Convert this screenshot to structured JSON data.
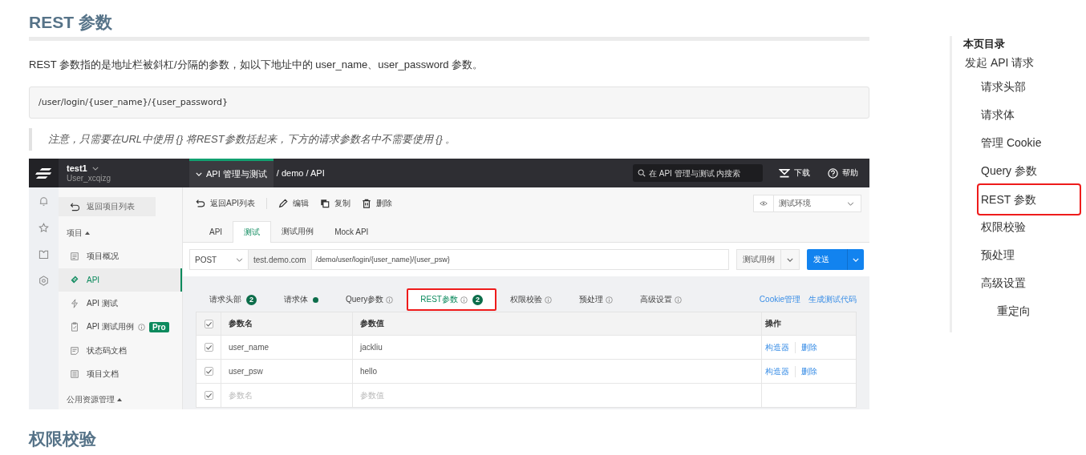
{
  "article": {
    "heading": "REST 参数",
    "intro": "REST 参数指的是地址栏被斜杠/分隔的参数，如以下地址中的 user_name、user_password 参数。",
    "code": "/user/login/{user_name}/{user_password}",
    "note": "注意，只需要在URL中使用 {} 将REST参数括起来，下方的请求参数名中不需要使用 {} 。",
    "next_heading": "权限校验"
  },
  "app": {
    "project": {
      "name": "test1",
      "user": "User_xcqizg"
    },
    "module": "API 管理与测试",
    "breadcrumb": "/ demo / API",
    "search_placeholder": "在 API 管理与测试 内搜索",
    "header_actions": [
      "下载",
      "帮助"
    ],
    "sidebar": {
      "back": "返回项目列表",
      "section": "项目",
      "items": [
        {
          "label": "项目概况",
          "selected": false
        },
        {
          "label": "API",
          "selected": true
        },
        {
          "label": "API 测试",
          "selected": false
        },
        {
          "label": "API 测试用例",
          "selected": false,
          "badge": "Pro"
        },
        {
          "label": "状态码文档",
          "selected": false
        },
        {
          "label": "项目文档",
          "selected": false
        }
      ],
      "footer_section": "公用资源管理"
    },
    "toolbar": [
      "返回API列表",
      "编辑",
      "复制",
      "删除"
    ],
    "environment": "测试环境",
    "tabs": [
      {
        "label": "API",
        "selected": false
      },
      {
        "label": "测试",
        "selected": true
      },
      {
        "label": "测试用例",
        "selected": false
      },
      {
        "label": "Mock API",
        "selected": false
      }
    ],
    "request": {
      "method": "POST",
      "host": "test.demo.com",
      "path": "/demo/user/login/{user_name}/{user_psw}",
      "case_button": "测试用例",
      "send_button": "发送"
    },
    "param_tabs": [
      {
        "label": "请求头部",
        "count": "2",
        "dot": false,
        "info": false,
        "selected": false,
        "highlighted": false
      },
      {
        "label": "请求体",
        "dot": true,
        "info": false,
        "selected": false,
        "highlighted": false
      },
      {
        "label": "Query参数",
        "dot": false,
        "info": true,
        "selected": false,
        "highlighted": false
      },
      {
        "label": "REST参数",
        "count": "2",
        "dot": false,
        "info": true,
        "selected": true,
        "highlighted": true
      },
      {
        "label": "权限校验",
        "dot": false,
        "info": true,
        "selected": false,
        "highlighted": false
      },
      {
        "label": "预处理",
        "dot": false,
        "info": true,
        "selected": false,
        "highlighted": false
      },
      {
        "label": "高级设置",
        "dot": false,
        "info": true,
        "selected": false,
        "highlighted": false
      }
    ],
    "links": [
      "Cookie管理",
      "生成测试代码"
    ],
    "table": {
      "columns": [
        "参数名",
        "参数值",
        "操作"
      ],
      "all_checked": true,
      "rows": [
        {
          "checked": true,
          "name": "user_name",
          "value": "jackliu",
          "actions": [
            "构造器",
            "删除"
          ]
        },
        {
          "checked": true,
          "name": "user_psw",
          "value": "hello",
          "actions": [
            "构造器",
            "删除"
          ]
        }
      ],
      "empty_row": {
        "checked": true,
        "name_placeholder": "参数名",
        "value_placeholder": "参数值"
      }
    }
  },
  "toc": {
    "title": "本页目录",
    "items": [
      {
        "label": "发起 API 请求",
        "highlighted": false,
        "children": [
          {
            "label": "请求头部",
            "highlighted": false
          },
          {
            "label": "请求体",
            "highlighted": false
          },
          {
            "label": "管理 Cookie",
            "highlighted": false
          },
          {
            "label": "Query 参数",
            "highlighted": false
          },
          {
            "label": "REST 参数",
            "highlighted": true
          },
          {
            "label": "权限校验",
            "highlighted": false
          },
          {
            "label": "预处理",
            "highlighted": false
          },
          {
            "label": "高级设置",
            "highlighted": false,
            "children": [
              {
                "label": "重定向",
                "highlighted": false
              }
            ]
          }
        ]
      }
    ]
  }
}
